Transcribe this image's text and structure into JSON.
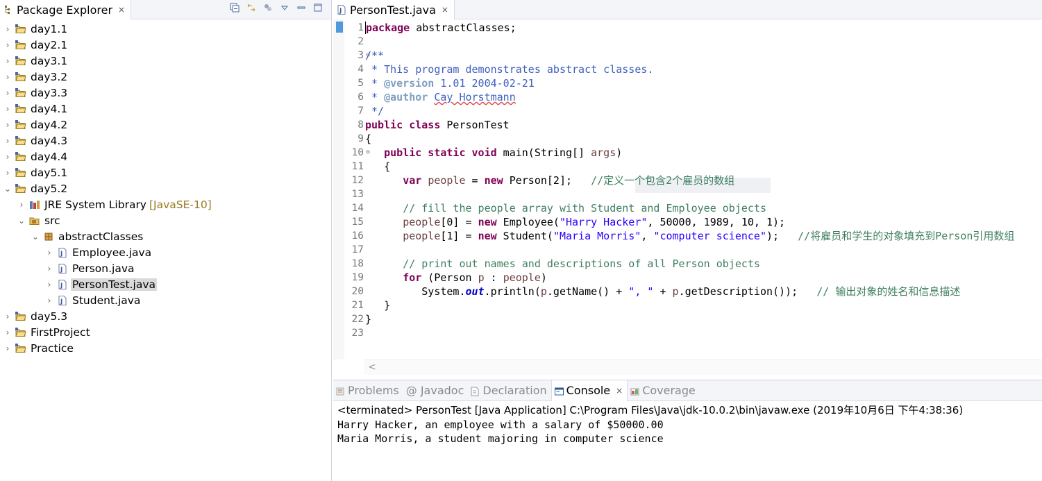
{
  "explorer": {
    "title": "Package Explorer",
    "close_glyph": "×",
    "toolbar_icons": [
      "collapse-all-icon",
      "link-with-editor-icon",
      "focus-icon",
      "view-menu-icon",
      "minimize-icon",
      "maximize-icon"
    ],
    "items": [
      {
        "label": "day1.1",
        "expanded": false
      },
      {
        "label": "day2.1",
        "expanded": false
      },
      {
        "label": "day3.1",
        "expanded": false
      },
      {
        "label": "day3.2",
        "expanded": false
      },
      {
        "label": "day3.3",
        "expanded": false
      },
      {
        "label": "day4.1",
        "expanded": false
      },
      {
        "label": "day4.2",
        "expanded": false
      },
      {
        "label": "day4.3",
        "expanded": false
      },
      {
        "label": "day4.4",
        "expanded": false
      },
      {
        "label": "day5.1",
        "expanded": false
      },
      {
        "label": "day5.2",
        "expanded": true
      },
      {
        "label": "JRE System Library",
        "decor": "[JavaSE-10]"
      },
      {
        "label": "src"
      },
      {
        "label": "abstractClasses"
      },
      {
        "label": "Employee.java"
      },
      {
        "label": "Person.java"
      },
      {
        "label": "PersonTest.java",
        "selected": true
      },
      {
        "label": "Student.java"
      },
      {
        "label": "day5.3",
        "expanded": false
      },
      {
        "label": "FirstProject",
        "expanded": false
      },
      {
        "label": "Practice",
        "expanded": false
      }
    ]
  },
  "editor": {
    "tab_title": "PersonTest.java",
    "close_glyph": "×",
    "line_numbers": [
      "1",
      "2",
      "3",
      "4",
      "5",
      "6",
      "7",
      "8",
      "9",
      "10",
      "11",
      "12",
      "13",
      "14",
      "15",
      "16",
      "17",
      "18",
      "19",
      "20",
      "21",
      "22",
      "23"
    ],
    "fold_glyph": "⊖",
    "scroll_left_glyph": "<",
    "lines": {
      "l1_kw": "package",
      "l1_rest": " abstractClasses;",
      "l3": "/**",
      "l4": " * This program demonstrates abstract classes.",
      "l5_pre": " * ",
      "l5_tag": "@version",
      "l5_rest": " 1.01 2004-02-21",
      "l6_pre": " * ",
      "l6_tag": "@author",
      "l6_sp": " ",
      "l6_name": "Cay Horstmann",
      "l7": " */",
      "l8_kw": "public class",
      "l8_rest": " PersonTest",
      "l9": "{",
      "l10_ind": "   ",
      "l10_kw": "public static void",
      "l10_rest": " main(String[] ",
      "l10_arg": "args",
      "l10_end": ")",
      "l11": "   {",
      "l12_ind": "      ",
      "l12_kw": "var",
      "l12_sp": " ",
      "l12_var": "people",
      "l12_mid": " = ",
      "l12_new": "new",
      "l12_rest": " Person[2];   ",
      "l12_cm": "//定义一个包含2个雇员的数组",
      "l14_ind": "      ",
      "l14_cm": "// fill the people array with Student and Employee objects",
      "l15_ind": "      ",
      "l15_var": "people",
      "l15_mid": "[0] = ",
      "l15_new": "new",
      "l15_pre": " Employee(",
      "l15_str": "\"Harry Hacker\"",
      "l15_rest": ", 50000, 1989, 10, 1);",
      "l16_ind": "      ",
      "l16_var": "people",
      "l16_mid": "[1] = ",
      "l16_new": "new",
      "l16_pre": " Student(",
      "l16_str1": "\"Maria Morris\"",
      "l16_sep": ", ",
      "l16_str2": "\"computer science\"",
      "l16_rest": ");   ",
      "l16_cm": "//将雇员和学生的对象填充到Person引用数组",
      "l18_ind": "      ",
      "l18_cm": "// print out names and descriptions of all Person objects",
      "l19_ind": "      ",
      "l19_kw": "for",
      "l19_pre": " (Person ",
      "l19_p": "p",
      "l19_mid": " : ",
      "l19_var": "people",
      "l19_end": ")",
      "l20_ind": "         ",
      "l20_pre": "System.",
      "l20_out": "out",
      "l20_mid": ".println(",
      "l20_p1": "p",
      "l20_mid2": ".getName() + ",
      "l20_str": "\", \"",
      "l20_mid3": " + ",
      "l20_p2": "p",
      "l20_rest": ".getDescription());   ",
      "l20_cm": "// 输出对象的姓名和信息描述",
      "l21": "   }",
      "l22": "}"
    }
  },
  "console": {
    "tabs": [
      {
        "label": "Problems",
        "icon": "problems-icon"
      },
      {
        "label": "@ Javadoc",
        "icon": ""
      },
      {
        "label": "Declaration",
        "icon": "declaration-icon"
      },
      {
        "label": "Console",
        "icon": "console-icon",
        "active": true
      },
      {
        "label": "Coverage",
        "icon": "coverage-icon"
      }
    ],
    "close_glyph": "×",
    "status": "<terminated> PersonTest [Java Application] C:\\Program Files\\Java\\jdk-10.0.2\\bin\\javaw.exe (2019年10月6日 下午4:38:36)",
    "output": [
      "Harry Hacker, an employee with a salary of $50000.00",
      "Maria Morris, a student majoring in computer science"
    ]
  }
}
